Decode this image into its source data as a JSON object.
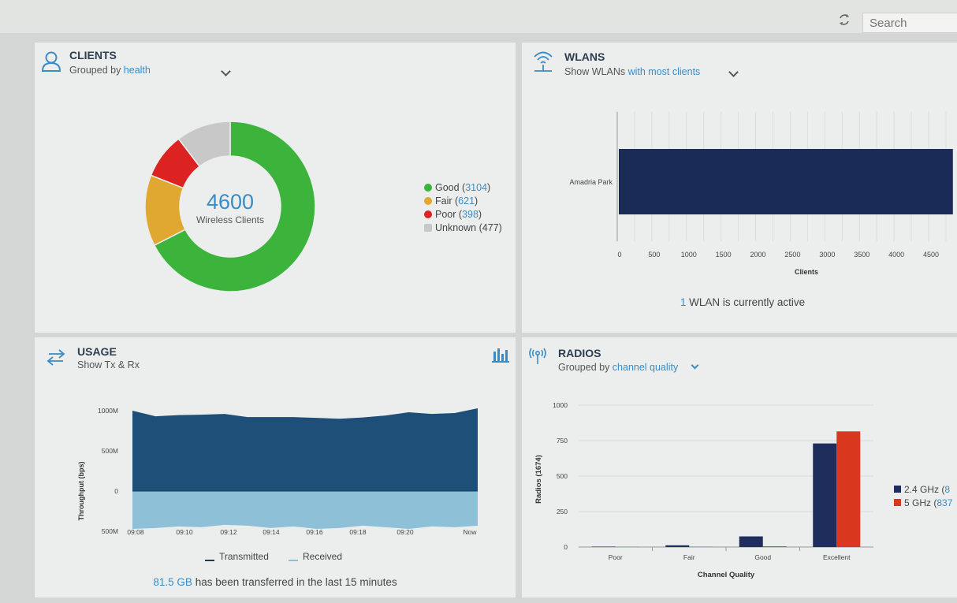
{
  "header": {
    "search_placeholder": "Search",
    "refresh_icon": "refresh-icon"
  },
  "clients": {
    "title": "CLIENTS",
    "grouped_prefix": "Grouped by ",
    "grouped_value": "health",
    "total": "4600",
    "total_label": "Wireless Clients",
    "legend": [
      {
        "label": "Good",
        "count": "3104",
        "color": "#3cb43c"
      },
      {
        "label": "Fair",
        "count": "621",
        "color": "#e0a830"
      },
      {
        "label": "Poor",
        "count": "398",
        "color": "#dd2222"
      },
      {
        "label": "Unknown",
        "count": "477",
        "color": "#c8c8c8"
      }
    ]
  },
  "wlans": {
    "title": "WLANS",
    "show_prefix": "Show WLANs ",
    "show_value": "with most clients",
    "active_count": "1",
    "active_text": " WLAN is currently active"
  },
  "usage": {
    "title": "USAGE",
    "subtitle": "Show Tx & Rx",
    "transferred_value": "81.5 GB",
    "transferred_text": " has been transferred in the last 15 minutes"
  },
  "radios": {
    "title": "RADIOS",
    "grouped_prefix": "Grouped by ",
    "grouped_value": "channel quality",
    "legend": [
      {
        "label": "2.4 GHz (",
        "count": "8",
        "color": "#1e2d5c"
      },
      {
        "label": "5 GHz (",
        "count": "837",
        "color": "#d9381e"
      }
    ]
  },
  "chart_data": [
    {
      "type": "pie",
      "categories": [
        "Good",
        "Fair",
        "Poor",
        "Unknown"
      ],
      "values": [
        3104,
        621,
        398,
        477
      ],
      "colors": [
        "#3cb43c",
        "#e0a830",
        "#dd2222",
        "#c8c8c8"
      ]
    },
    {
      "type": "bar",
      "orientation": "horizontal",
      "categories": [
        "Amadria Park"
      ],
      "values": [
        4600
      ],
      "xlabel": "Clients",
      "xlim": [
        0,
        5000
      ],
      "xticks": [
        "0",
        "500",
        "1000",
        "1500",
        "2000",
        "2500",
        "3000",
        "3500",
        "4000",
        "4500",
        "5"
      ],
      "color": "#1a2b57"
    },
    {
      "type": "area",
      "x": [
        "09:08",
        "09:10",
        "09:12",
        "09:14",
        "09:16",
        "09:18",
        "09:20",
        "Now"
      ],
      "yticks": [
        "1500M",
        "1000M",
        "500M",
        "0",
        "500M"
      ],
      "ylabel": "Throughput (bps)",
      "series": [
        {
          "name": "Transmitted",
          "color": "#1e4f78",
          "values": [
            1000,
            930,
            945,
            950,
            960,
            920,
            920,
            920,
            910,
            900,
            915,
            940,
            980,
            960,
            970,
            1030
          ]
        },
        {
          "name": "Received",
          "color": "#8ec0d8",
          "values": [
            -470,
            -460,
            -440,
            -450,
            -420,
            -430,
            -460,
            -440,
            -470,
            -460,
            -430,
            -450,
            -470,
            -440,
            -450,
            -430
          ]
        }
      ]
    },
    {
      "type": "bar",
      "categories": [
        "Poor",
        "Fair",
        "Good",
        "Excellent"
      ],
      "xlabel": "Channel Quality",
      "ylabel": "Radios (1674)",
      "ylim": [
        0,
        1000
      ],
      "yticks": [
        "0",
        "250",
        "500",
        "750",
        "1000"
      ],
      "series": [
        {
          "name": "2.4 GHz",
          "color": "#1e2d5c",
          "values": [
            3,
            12,
            75,
            730
          ]
        },
        {
          "name": "5 GHz",
          "color": "#d9381e",
          "values": [
            1,
            2,
            5,
            815
          ]
        }
      ]
    }
  ]
}
